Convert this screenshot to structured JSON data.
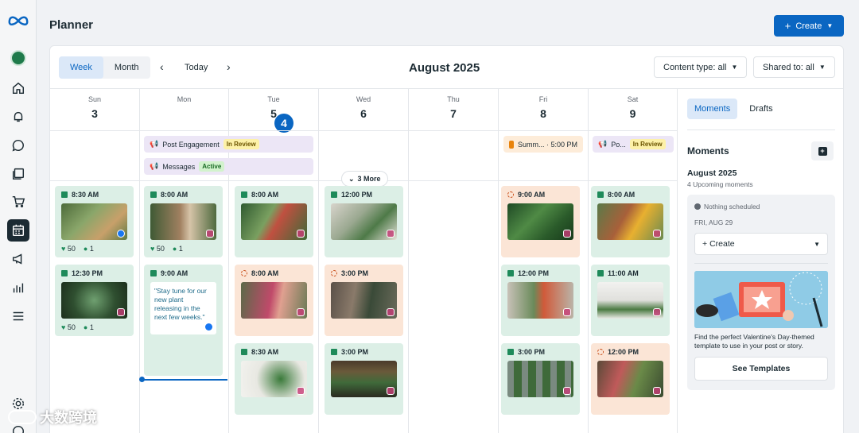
{
  "app": {
    "title": "Planner",
    "create_label": "Create",
    "nav_icons": [
      "meta-logo",
      "home-icon",
      "bell-icon",
      "chat-icon",
      "posts-icon",
      "cart-icon",
      "calendar-icon",
      "megaphone-icon",
      "insights-icon",
      "menu-icon",
      "settings-icon",
      "help-icon"
    ]
  },
  "toolbar": {
    "week_label": "Week",
    "month_label": "Month",
    "today_label": "Today",
    "month_title": "August 2025",
    "content_type": "Content type: all",
    "shared_to": "Shared to: all"
  },
  "days": [
    {
      "name": "Sun",
      "num": "3"
    },
    {
      "name": "Mon",
      "num": "4"
    },
    {
      "name": "Tue",
      "num": "5"
    },
    {
      "name": "Wed",
      "num": "6"
    },
    {
      "name": "Thu",
      "num": "7"
    },
    {
      "name": "Fri",
      "num": "8"
    },
    {
      "name": "Sat",
      "num": "9"
    }
  ],
  "allday": {
    "post_engagement": "Post Engagement",
    "in_review": "In Review",
    "messages": "Messages",
    "active": "Active",
    "summer": "Summ... · 5:00 PM",
    "po": "Po...",
    "in_review2": "In Review",
    "more": "3 More"
  },
  "posts": {
    "sun1": {
      "time": "8:30 AM",
      "likes": "50",
      "comments": "1"
    },
    "sun2": {
      "time": "12:30 PM",
      "likes": "50",
      "comments": "1"
    },
    "mon1": {
      "time": "8:00 AM",
      "likes": "50",
      "comments": "1"
    },
    "mon2": {
      "time": "9:00 AM",
      "quote": "\"Stay tune for our new plant releasing in the next few weeks.\""
    },
    "tue1": {
      "time": "8:00 AM"
    },
    "tue2": {
      "time": "8:00 AM"
    },
    "tue3": {
      "time": "8:30 AM"
    },
    "wed1": {
      "time": "12:00 PM"
    },
    "wed2": {
      "time": "3:00 PM"
    },
    "wed3": {
      "time": "3:00 PM"
    },
    "fri1": {
      "time": "9:00 AM"
    },
    "fri2": {
      "time": "12:00 PM"
    },
    "fri3": {
      "time": "3:00 PM"
    },
    "sat1": {
      "time": "8:00 AM"
    },
    "sat2": {
      "time": "11:00 AM"
    },
    "sat3": {
      "time": "12:00 PM"
    }
  },
  "panel": {
    "tab_moments": "Moments",
    "tab_drafts": "Drafts",
    "heading": "Moments",
    "month": "August 2025",
    "upcoming": "4 Upcoming moments",
    "nothing": "Nothing scheduled",
    "date": "FRI, AUG 29",
    "create": "Create",
    "promo_text": "Find the perfect Valentine's Day-themed template to use in your post or story.",
    "see_templates": "See Templates"
  },
  "watermark": "大数跨境",
  "colors": {
    "accent": "#0a66c2",
    "green_card": "#dcefe6",
    "peach_card": "#fbe5d6"
  }
}
